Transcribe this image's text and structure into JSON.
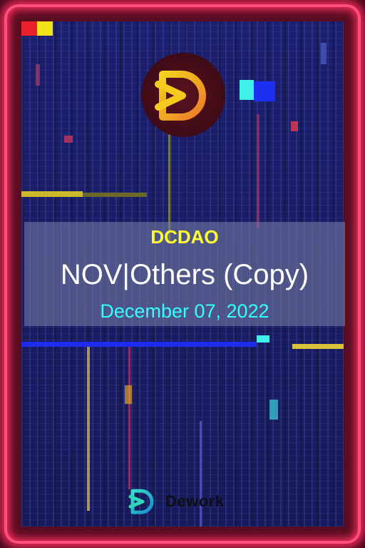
{
  "card": {
    "organization": "DCDAO",
    "title": "NOV|Others (Copy)",
    "date": "December 07, 2022"
  },
  "footer": {
    "brand_name": "Dework"
  },
  "icons": {
    "top_logo": "dcdao-logo-icon",
    "footer_logo": "dework-logo-icon"
  },
  "colors": {
    "frame_glow": "#ff2f63",
    "organization_text": "#ffff33",
    "title_text": "#ffffff",
    "date_text": "#33ffff",
    "background": "#1a1c63"
  }
}
